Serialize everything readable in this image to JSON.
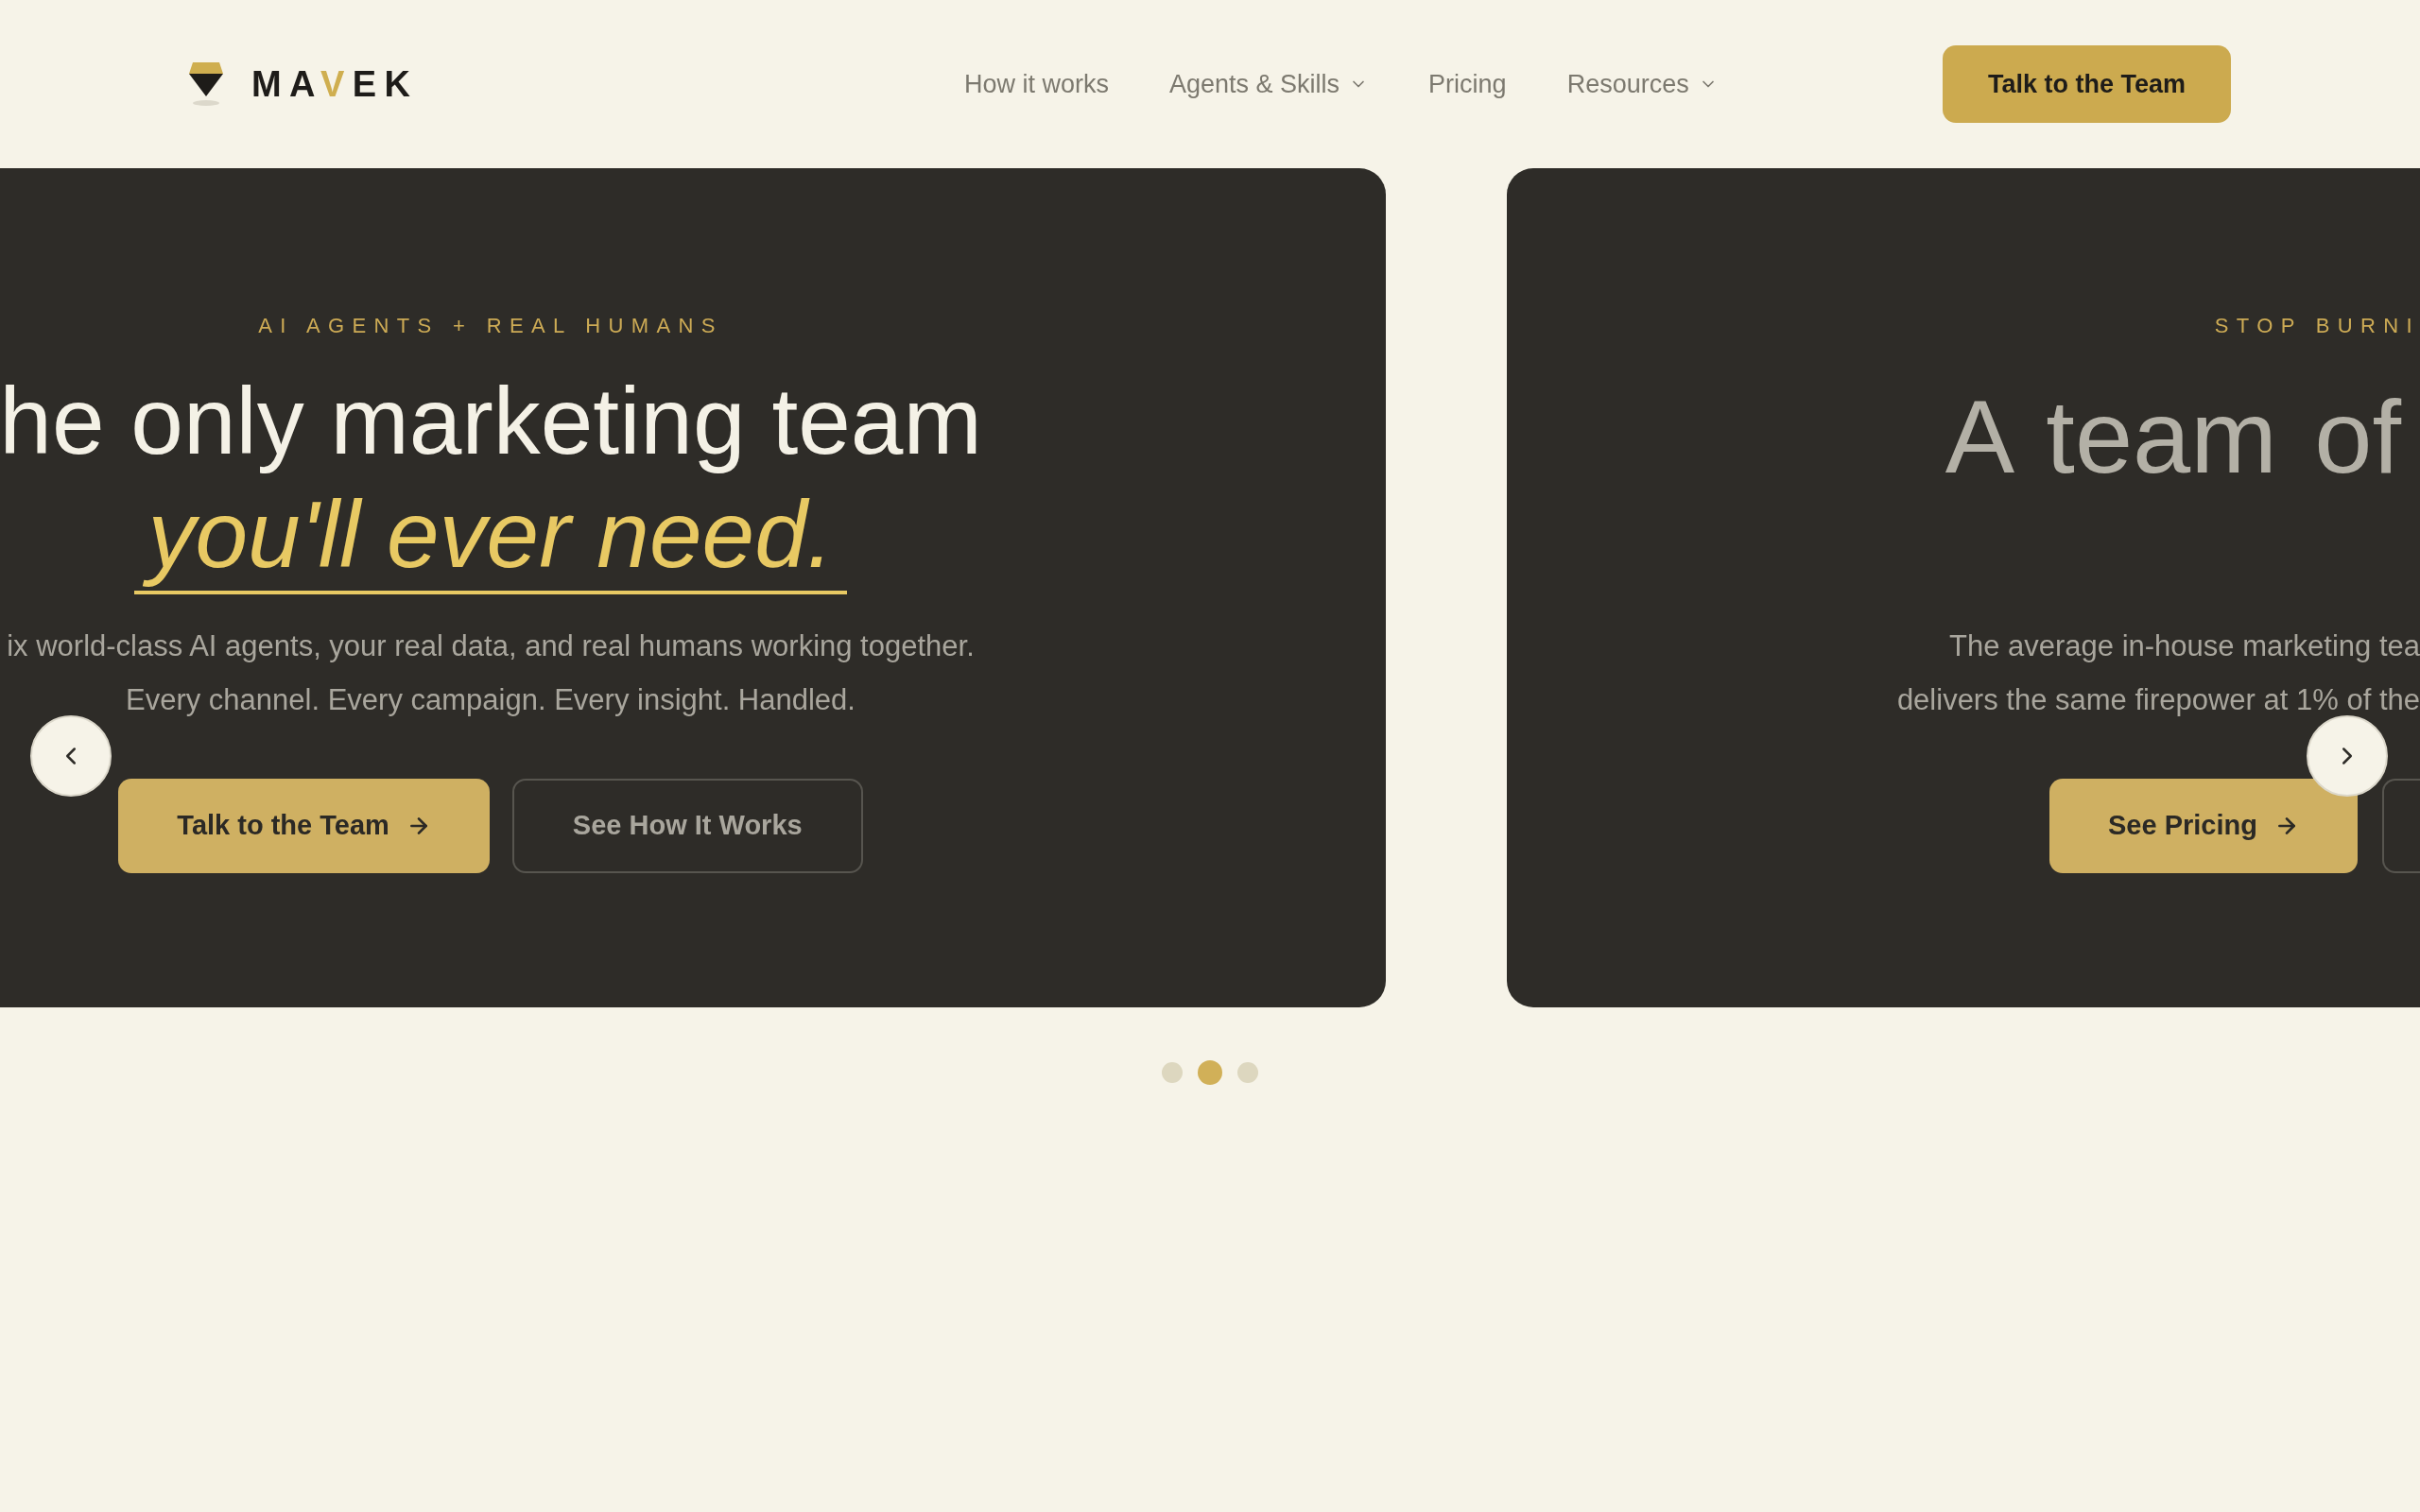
{
  "header": {
    "logo_parts": [
      {
        "text": "MA",
        "accent": false
      },
      {
        "text": "V",
        "accent": true
      },
      {
        "text": "EK",
        "accent": false
      }
    ],
    "nav": [
      {
        "label": "How it works",
        "has_menu": false
      },
      {
        "label": "Agents & Skills",
        "has_menu": true
      },
      {
        "label": "Pricing",
        "has_menu": false
      },
      {
        "label": "Resources",
        "has_menu": true
      }
    ],
    "cta": "Talk to the Team"
  },
  "slides": [
    {
      "eyebrow": "AI AGENTS + REAL HUMANS",
      "heading": "he only marketing team",
      "heading_accent": "you'll ever need.",
      "subtitle_lines": [
        "ix world-class AI agents, your real data, and real humans working together.",
        "Every channel. Every campaign. Every insight. Handled."
      ],
      "buttons": [
        {
          "label": "Talk to the Team",
          "kind": "primary"
        },
        {
          "label": "See How It Works",
          "kind": "outline"
        }
      ]
    },
    {
      "eyebrow": "STOP BURNI",
      "heading": "A team of",
      "subtitle_lines": [
        "The average in-house marketing tea",
        "delivers the same firepower at 1% of the"
      ],
      "buttons": [
        {
          "label": "See Pricing",
          "kind": "primary"
        },
        {
          "kind": "outline"
        }
      ]
    }
  ],
  "dots": [
    {
      "selected": false
    },
    {
      "selected": true
    },
    {
      "selected": false
    }
  ]
}
